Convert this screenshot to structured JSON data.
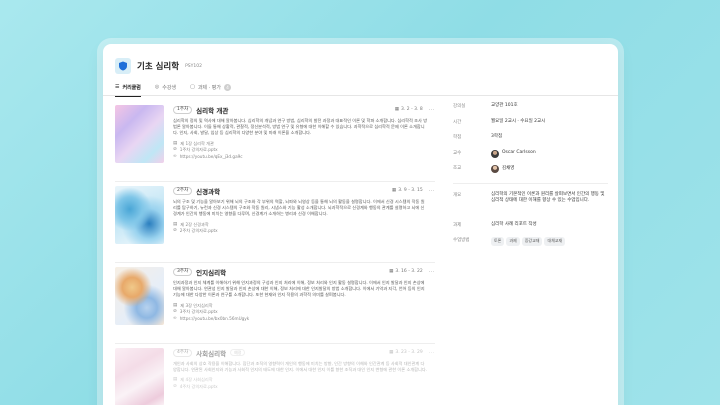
{
  "course": {
    "title": "기초 심리학",
    "code": "PSY102",
    "icon": "shield-icon"
  },
  "tabs": [
    {
      "label": "커리큘럼",
      "icon": "curriculum-icon",
      "active": true
    },
    {
      "label": "수강생",
      "icon": "people-icon",
      "active": false
    },
    {
      "label": "과제 · 평가",
      "icon": "assignment-icon",
      "count": "4",
      "active": false
    }
  ],
  "lessons": [
    {
      "week": "1주차",
      "title": "심리학 개관",
      "date": "3. 2 - 3. 8",
      "description": "심리학의 정의 및 역사에 대해 알아봅니다. 심리학의 개념과 연구 방법, 심리학의 발전 과정과 대표적인 이론 및 학파 소개합니다. 심리학적 조사 방법론 알아봅니다. 이들 통해 상황적, 관찰적, 정신분석적, 방법 연구 및 유형에 대한 이해할 수 있습니다. 과학적으로 심리학적 문제 이론 소개합니다. 인지, 사회, 발달, 임상 등 심리학의 다양한 분야 및 미래 이론을 소개합니다.",
      "files": [
        {
          "icon": "file-icon",
          "name": "제 1장 심리학 개관"
        },
        {
          "icon": "attach-icon",
          "name": "1주차 강의자료.pptx"
        },
        {
          "icon": "link-icon",
          "name": "https://youtu.be/qEx_j3d.ga9c"
        }
      ]
    },
    {
      "week": "2주차",
      "title": "신경과학",
      "date": "3. 9 - 3. 15",
      "description": "뇌의 구조 및 기능을 알아보기 위해 뇌의 구조와 각 부위의 역할, 뇌파와 뇌영상 등을 통해 뇌의 활동을 설명합니다. 이에서 신경 시스템의 작동 원리를 탐구하기, 뉴런과 신경 시스템의 구조와 작동 원리, 시냅스와 기능 활성 소개합니다. 뇌과학적으로 신경계와 행동의 관계를 설명하고 뇌에 신경계가 인간의 행동에 미치는 영향을 다루며, 신경계가 소개하는 병리과 신경 이해합니다.",
      "files": [
        {
          "icon": "file-icon",
          "name": "제 2장 신경과학"
        },
        {
          "icon": "attach-icon",
          "name": "2주차 강의자료.pptx"
        }
      ]
    },
    {
      "week": "3주차",
      "title": "인지심리학",
      "date": "3. 16 - 3. 22",
      "description": "인지과정과 인지 체계를 이해하기 위해 인지과정의 구성과 인지 처리에 이해, 정보 처리와 인지 활동 설명합니다. 이에서 인지 발달과 인지 손상에 대해 알아봅니다. 연관성 인지 발달과 인지 손상에 대한 이해, 정보 처리에 대한 인지발달의 방법 소개합니다. 이에서 기억과 지각, 언어 등의 인지 기능에 대한 다양한 이론과 연구를 소개합니다. 또한 현재와 인지 작용의 과학적 의미를 살펴봅니다.",
      "files": [
        {
          "icon": "file-icon",
          "name": "제 3장 인지심리학"
        },
        {
          "icon": "attach-icon",
          "name": "3주차 강의자료.pptx"
        },
        {
          "icon": "link-icon",
          "name": "https://youtu.be/bx0bn.56mUgyk"
        }
      ]
    },
    {
      "week": "4주차",
      "title": "사회심리학",
      "tag": "예정",
      "date": "3. 23 - 3. 29",
      "description": "개인과 사회의 상호 작용을 이해합니다. 집단과 조직의 영향력이 개인의 행동에 미치는 방향, 인간 방향의 이해와 인간관계 등 사회적 대인관계 다양합니다. 연관된 사회인지와 기능과 사회적 인지의 태도에 대한 인지. 이에서 대한 인지 이를 향한 조직과 대인 인지 변형에 관한 이론 소개합니다.",
      "files": [
        {
          "icon": "file-icon",
          "name": "제 4장 사회심리학"
        },
        {
          "icon": "attach-icon",
          "name": "4주차 강의자료.pptx"
        }
      ]
    }
  ],
  "info": {
    "location": {
      "label": "강의실",
      "value": "교양관 101호"
    },
    "time": {
      "label": "시간",
      "value": "월요일 2교시 · 수요일 2교시"
    },
    "credits": {
      "label": "학점",
      "value": "3학점"
    },
    "professor": {
      "label": "교수",
      "value": "Oscar Carlsson"
    },
    "ta": {
      "label": "조교",
      "value": "김채영"
    },
    "overview": {
      "label": "개요",
      "value": "심리학의 기본적인 이론과 원리를 살펴보면서 인간의 행동 및 심리적 상태에 대한 이해를 향상 수 있는 수업입니다."
    },
    "assignment": {
      "label": "과제",
      "value": "심리학 사례 리포트 작성"
    },
    "method": {
      "label": "수업방법",
      "chips": [
        "토론",
        "과제",
        "증강교재",
        "대체교재"
      ]
    }
  },
  "colors": {
    "accent": "#1e6fd9",
    "background": "#9fe3ea"
  }
}
